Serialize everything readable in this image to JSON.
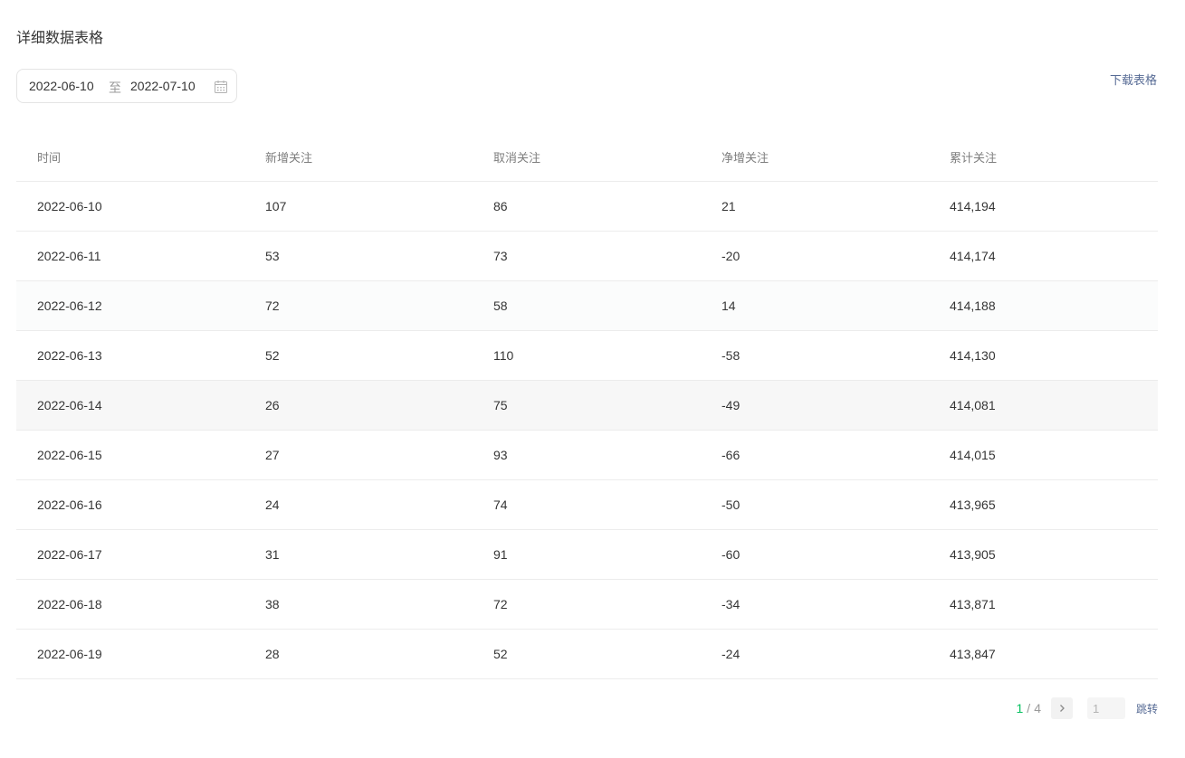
{
  "title": "详细数据表格",
  "date_range": {
    "start": "2022-06-10",
    "separator": "至",
    "end": "2022-07-10"
  },
  "download_label": "下载表格",
  "table": {
    "columns": [
      "时间",
      "新增关注",
      "取消关注",
      "净增关注",
      "累计关注"
    ],
    "rows": [
      [
        "2022-06-10",
        "107",
        "86",
        "21",
        "414,194"
      ],
      [
        "2022-06-11",
        "53",
        "73",
        "-20",
        "414,174"
      ],
      [
        "2022-06-12",
        "72",
        "58",
        "14",
        "414,188"
      ],
      [
        "2022-06-13",
        "52",
        "110",
        "-58",
        "414,130"
      ],
      [
        "2022-06-14",
        "26",
        "75",
        "-49",
        "414,081"
      ],
      [
        "2022-06-15",
        "27",
        "93",
        "-66",
        "414,015"
      ],
      [
        "2022-06-16",
        "24",
        "74",
        "-50",
        "413,965"
      ],
      [
        "2022-06-17",
        "31",
        "91",
        "-60",
        "413,905"
      ],
      [
        "2022-06-18",
        "38",
        "72",
        "-34",
        "413,871"
      ],
      [
        "2022-06-19",
        "28",
        "52",
        "-24",
        "413,847"
      ]
    ]
  },
  "pagination": {
    "current": "1",
    "separator": "/",
    "total": "4",
    "input_placeholder": "1",
    "jump_label": "跳转"
  },
  "icons": {
    "calendar": "calendar-icon",
    "next": "chevron-right-icon"
  },
  "colors": {
    "accent": "#07c160",
    "link": "#576b95"
  }
}
